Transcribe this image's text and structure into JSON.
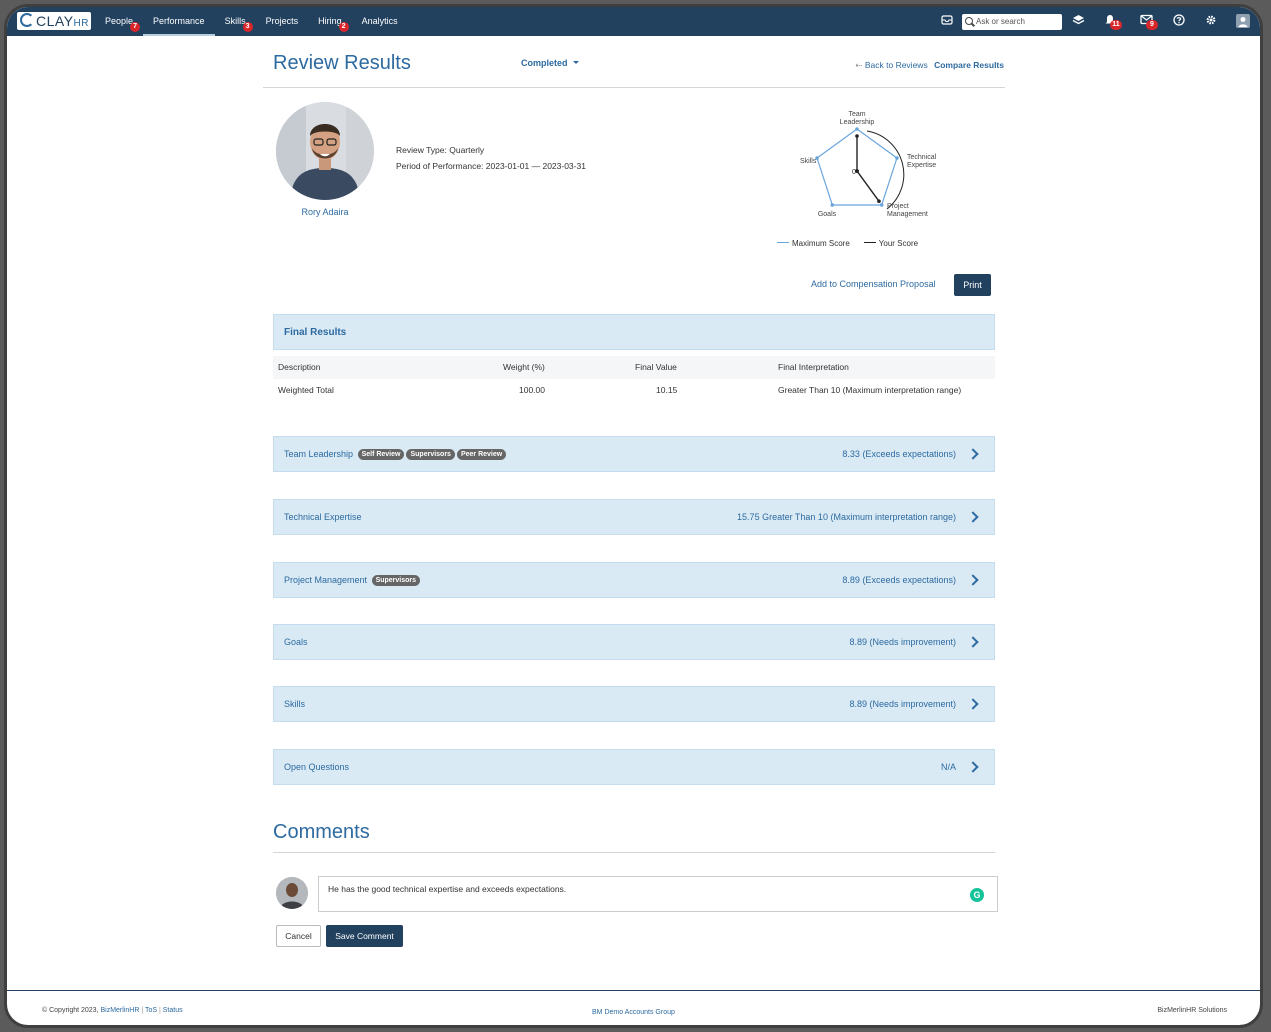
{
  "topbar": {
    "logo": {
      "main": "CLAY",
      "sub": "HR"
    },
    "nav": [
      {
        "label": "People",
        "badge": "7"
      },
      {
        "label": "Performance",
        "badge": ""
      },
      {
        "label": "Skills",
        "badge": "3"
      },
      {
        "label": "Projects",
        "badge": ""
      },
      {
        "label": "Hiring",
        "badge": "2"
      },
      {
        "label": "Analytics",
        "badge": ""
      }
    ],
    "search_placeholder": "Ask or search",
    "notifications_badge": "11",
    "messages_badge": "9"
  },
  "header": {
    "title": "Review Results",
    "status": "Completed",
    "back_link": "Back to Reviews",
    "compare_link": "Compare Results"
  },
  "employee": {
    "name": "Rory Adaira",
    "review_type": "Review Type: Quarterly",
    "period": "Period of Performance: 2023-01-01 — 2023-03-31"
  },
  "chart_data": {
    "type": "radar",
    "categories": [
      "Team Leadership",
      "Technical Expertise",
      "Project Management",
      "Goals",
      "Skills"
    ],
    "center_label": "0",
    "series": [
      {
        "name": "Maximum Score",
        "values": [
          10,
          10,
          10,
          10,
          10
        ],
        "color": "#6aa6dc"
      },
      {
        "name": "Your Score",
        "values": [
          8.33,
          0,
          8.89,
          0,
          0
        ],
        "color": "#222222"
      }
    ]
  },
  "actions": {
    "add_compensation": "Add to Compensation Proposal",
    "print": "Print"
  },
  "final_results": {
    "title": "Final Results",
    "columns": [
      "Description",
      "Weight (%)",
      "Final Value",
      "Final Interpretation"
    ],
    "row": {
      "description": "Weighted Total",
      "weight": "100.00",
      "value": "10.15",
      "interpretation": "Greater Than 10 (Maximum interpretation range)"
    }
  },
  "sections": [
    {
      "title": "Team Leadership",
      "badges": [
        "Self Review",
        "Supervisors",
        "Peer Review"
      ],
      "value": "8.33 (Exceeds expectations)"
    },
    {
      "title": "Technical Expertise",
      "badges": [],
      "value": "15.75 Greater Than 10 (Maximum interpretation range)"
    },
    {
      "title": "Project Management",
      "badges": [
        "Supervisors"
      ],
      "value": "8.89 (Exceeds expectations)"
    },
    {
      "title": "Goals",
      "badges": [],
      "value": "8.89 (Needs improvement)"
    },
    {
      "title": "Skills",
      "badges": [],
      "value": "8.89 (Needs improvement)"
    },
    {
      "title": "Open Questions",
      "badges": [],
      "value": "N/A"
    }
  ],
  "comments": {
    "title": "Comments",
    "text": "He has the good technical expertise and exceeds expectations.",
    "cancel": "Cancel",
    "save": "Save Comment"
  },
  "footer": {
    "copyright": "© Copyright 2023,",
    "company_link": "BizMerlinHR",
    "tos": "ToS",
    "status": "Status",
    "group": "BM Demo Accounts Group",
    "right": "BizMerlinHR Solutions"
  }
}
